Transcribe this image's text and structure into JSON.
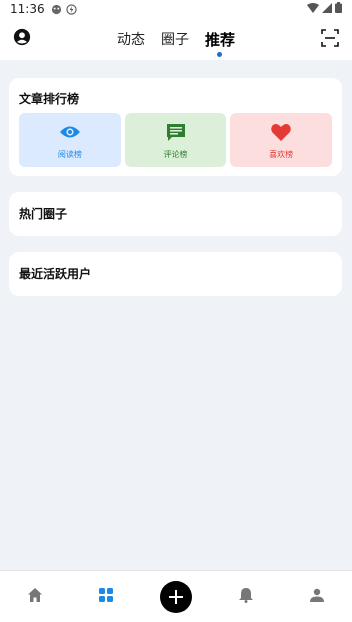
{
  "status_bar": {
    "time": "11:36"
  },
  "top_tabs": [
    {
      "label": "动态"
    },
    {
      "label": "圈子"
    },
    {
      "label": "推荐"
    }
  ],
  "active_tab": "推荐",
  "article_ranking": {
    "title": "文章排行榜",
    "tiles": [
      {
        "label": "阅读榜",
        "icon": "eye-icon",
        "bg": "#dbeafe",
        "fg": "#1e88e5"
      },
      {
        "label": "评论榜",
        "icon": "comment-icon",
        "bg": "#dcefd8",
        "fg": "#2e7d32"
      },
      {
        "label": "喜欢榜",
        "icon": "heart-icon",
        "bg": "#fddede",
        "fg": "#e53935"
      }
    ]
  },
  "hot_circles": {
    "title": "热门圈子"
  },
  "recent_active_users": {
    "title": "最近活跃用户"
  },
  "bottom_nav": {
    "items": [
      "home-icon",
      "grid-icon",
      "add-icon",
      "bell-icon",
      "person-icon"
    ],
    "active": "grid-icon",
    "active_color": "#1e88e5",
    "inactive_color": "#777777"
  }
}
